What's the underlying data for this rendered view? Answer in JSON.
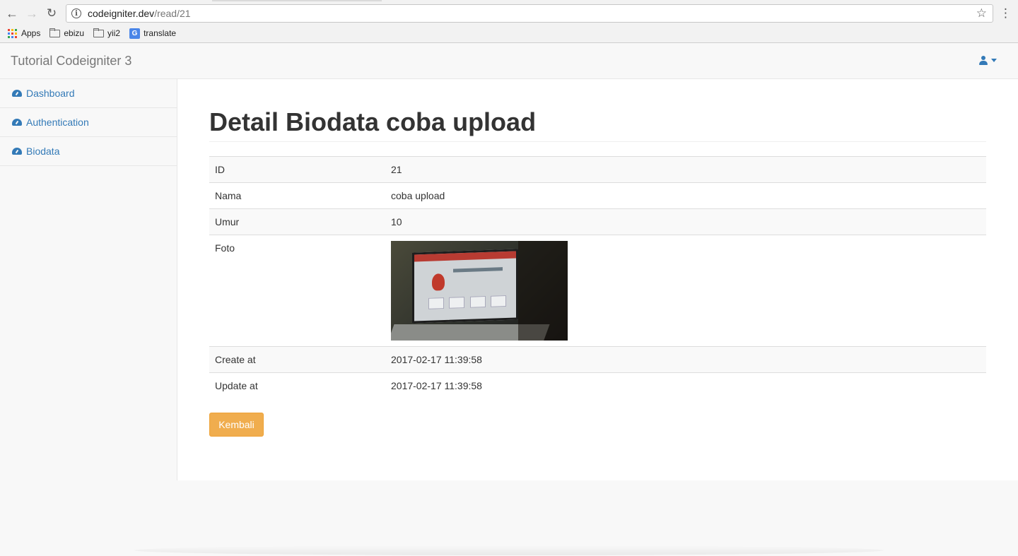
{
  "browser": {
    "url_host": "codeigniter.dev",
    "url_path": "/read/21",
    "bookmarks": [
      {
        "label": "Apps",
        "icon": "apps-grid-icon"
      },
      {
        "label": "ebizu",
        "icon": "folder-icon"
      },
      {
        "label": "yii2",
        "icon": "folder-icon"
      },
      {
        "label": "translate",
        "icon": "translate-icon"
      }
    ]
  },
  "navbar": {
    "brand": "Tutorial Codeigniter 3",
    "user_icon": "user-icon",
    "accent_color": "#337ab7"
  },
  "sidebar": {
    "items": [
      {
        "label": "Dashboard",
        "icon": "dashboard-icon"
      },
      {
        "label": "Authentication",
        "icon": "dashboard-icon"
      },
      {
        "label": "Biodata",
        "icon": "dashboard-icon"
      }
    ]
  },
  "main": {
    "title": "Detail Biodata coba upload",
    "rows": [
      {
        "label": "ID",
        "value": "21"
      },
      {
        "label": "Nama",
        "value": "coba upload"
      },
      {
        "label": "Umur",
        "value": "10"
      },
      {
        "label": "Foto",
        "value": ""
      },
      {
        "label": "Create at",
        "value": "2017-02-17 11:39:58"
      },
      {
        "label": "Update at",
        "value": "2017-02-17 11:39:58"
      }
    ],
    "back_button": "Kembali",
    "button_color": "#f0ad4e"
  }
}
